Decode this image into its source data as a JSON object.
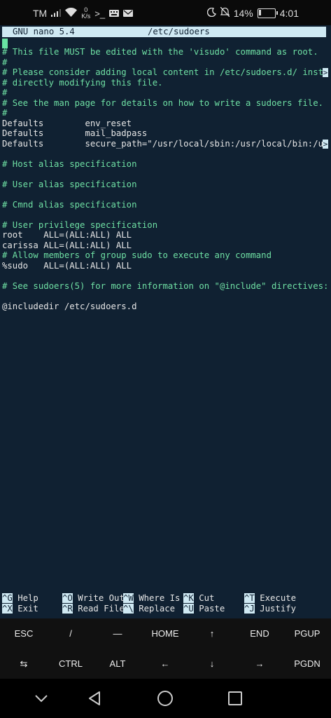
{
  "status_bar": {
    "carrier": "TM",
    "speed_value": "0",
    "speed_unit": "K/s",
    "battery_percent": "14%",
    "battery_level": 0.14,
    "time": "4:01"
  },
  "nano": {
    "version_label": "GNU nano 5.4",
    "filename": "/etc/sudoers",
    "lines": [
      {
        "text": "# This file MUST be edited with the 'visudo' command as root.",
        "kind": "comment"
      },
      {
        "text": "#",
        "kind": "comment"
      },
      {
        "text": "# Please consider adding local content in /etc/sudoers.d/ inste",
        "kind": "comment",
        "truncated": true
      },
      {
        "text": "# directly modifying this file.",
        "kind": "comment"
      },
      {
        "text": "#",
        "kind": "comment"
      },
      {
        "text": "# See the man page for details on how to write a sudoers file.",
        "kind": "comment"
      },
      {
        "text": "#",
        "kind": "comment"
      },
      {
        "text": "Defaults        env_reset",
        "kind": "code"
      },
      {
        "text": "Defaults        mail_badpass",
        "kind": "code"
      },
      {
        "text": "Defaults        secure_path=\"/usr/local/sbin:/usr/local/bin:/us",
        "kind": "code",
        "truncated": true
      },
      {
        "text": "",
        "kind": "code"
      },
      {
        "text": "# Host alias specification",
        "kind": "comment"
      },
      {
        "text": "",
        "kind": "code"
      },
      {
        "text": "# User alias specification",
        "kind": "comment"
      },
      {
        "text": "",
        "kind": "code"
      },
      {
        "text": "# Cmnd alias specification",
        "kind": "comment"
      },
      {
        "text": "",
        "kind": "code"
      },
      {
        "text": "# User privilege specification",
        "kind": "comment"
      },
      {
        "text": "root    ALL=(ALL:ALL) ALL",
        "kind": "code"
      },
      {
        "text": "carissa ALL=(ALL:ALL) ALL",
        "kind": "code"
      },
      {
        "text": "# Allow members of group sudo to execute any command",
        "kind": "comment"
      },
      {
        "text": "%sudo   ALL=(ALL:ALL) ALL",
        "kind": "code"
      },
      {
        "text": "",
        "kind": "code"
      },
      {
        "text": "# See sudoers(5) for more information on \"@include\" directives:",
        "kind": "comment"
      },
      {
        "text": "",
        "kind": "code"
      },
      {
        "text": "@includedir /etc/sudoers.d",
        "kind": "code"
      }
    ],
    "more_indicator": ">",
    "shortcuts_row1": [
      {
        "key": "^G",
        "label": "Help"
      },
      {
        "key": "^O",
        "label": "Write Out"
      },
      {
        "key": "^W",
        "label": "Where Is"
      },
      {
        "key": "^K",
        "label": "Cut"
      },
      {
        "key": "^T",
        "label": "Execute"
      }
    ],
    "shortcuts_row2": [
      {
        "key": "^X",
        "label": "Exit"
      },
      {
        "key": "^R",
        "label": "Read File"
      },
      {
        "key": "^\\",
        "label": "Replace"
      },
      {
        "key": "^U",
        "label": "Paste"
      },
      {
        "key": "^J",
        "label": "Justify"
      }
    ]
  },
  "extra_keys": {
    "row1": [
      "ESC",
      "/",
      "—",
      "HOME",
      "↑",
      "END",
      "PGUP"
    ],
    "row2": [
      "⇆",
      "CTRL",
      "ALT",
      "←",
      "↓",
      "→",
      "PGDN"
    ]
  },
  "colors": {
    "terminal_bg": "#102132",
    "comment": "#6fe0a4",
    "highlight": "#cfe9f3"
  }
}
